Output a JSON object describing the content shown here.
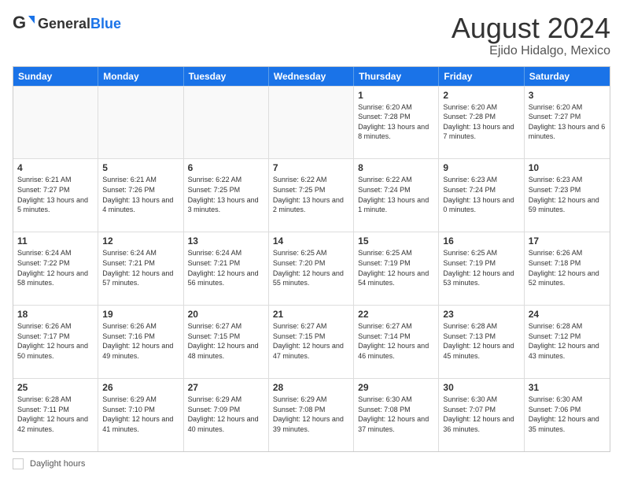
{
  "header": {
    "logo_general": "General",
    "logo_blue": "Blue",
    "main_title": "August 2024",
    "sub_title": "Ejido Hidalgo, Mexico"
  },
  "calendar": {
    "days_of_week": [
      "Sunday",
      "Monday",
      "Tuesday",
      "Wednesday",
      "Thursday",
      "Friday",
      "Saturday"
    ],
    "rows": [
      [
        {
          "day": "",
          "info": ""
        },
        {
          "day": "",
          "info": ""
        },
        {
          "day": "",
          "info": ""
        },
        {
          "day": "",
          "info": ""
        },
        {
          "day": "1",
          "info": "Sunrise: 6:20 AM\nSunset: 7:28 PM\nDaylight: 13 hours and 8 minutes."
        },
        {
          "day": "2",
          "info": "Sunrise: 6:20 AM\nSunset: 7:28 PM\nDaylight: 13 hours and 7 minutes."
        },
        {
          "day": "3",
          "info": "Sunrise: 6:20 AM\nSunset: 7:27 PM\nDaylight: 13 hours and 6 minutes."
        }
      ],
      [
        {
          "day": "4",
          "info": "Sunrise: 6:21 AM\nSunset: 7:27 PM\nDaylight: 13 hours and 5 minutes."
        },
        {
          "day": "5",
          "info": "Sunrise: 6:21 AM\nSunset: 7:26 PM\nDaylight: 13 hours and 4 minutes."
        },
        {
          "day": "6",
          "info": "Sunrise: 6:22 AM\nSunset: 7:25 PM\nDaylight: 13 hours and 3 minutes."
        },
        {
          "day": "7",
          "info": "Sunrise: 6:22 AM\nSunset: 7:25 PM\nDaylight: 13 hours and 2 minutes."
        },
        {
          "day": "8",
          "info": "Sunrise: 6:22 AM\nSunset: 7:24 PM\nDaylight: 13 hours and 1 minute."
        },
        {
          "day": "9",
          "info": "Sunrise: 6:23 AM\nSunset: 7:24 PM\nDaylight: 13 hours and 0 minutes."
        },
        {
          "day": "10",
          "info": "Sunrise: 6:23 AM\nSunset: 7:23 PM\nDaylight: 12 hours and 59 minutes."
        }
      ],
      [
        {
          "day": "11",
          "info": "Sunrise: 6:24 AM\nSunset: 7:22 PM\nDaylight: 12 hours and 58 minutes."
        },
        {
          "day": "12",
          "info": "Sunrise: 6:24 AM\nSunset: 7:21 PM\nDaylight: 12 hours and 57 minutes."
        },
        {
          "day": "13",
          "info": "Sunrise: 6:24 AM\nSunset: 7:21 PM\nDaylight: 12 hours and 56 minutes."
        },
        {
          "day": "14",
          "info": "Sunrise: 6:25 AM\nSunset: 7:20 PM\nDaylight: 12 hours and 55 minutes."
        },
        {
          "day": "15",
          "info": "Sunrise: 6:25 AM\nSunset: 7:19 PM\nDaylight: 12 hours and 54 minutes."
        },
        {
          "day": "16",
          "info": "Sunrise: 6:25 AM\nSunset: 7:19 PM\nDaylight: 12 hours and 53 minutes."
        },
        {
          "day": "17",
          "info": "Sunrise: 6:26 AM\nSunset: 7:18 PM\nDaylight: 12 hours and 52 minutes."
        }
      ],
      [
        {
          "day": "18",
          "info": "Sunrise: 6:26 AM\nSunset: 7:17 PM\nDaylight: 12 hours and 50 minutes."
        },
        {
          "day": "19",
          "info": "Sunrise: 6:26 AM\nSunset: 7:16 PM\nDaylight: 12 hours and 49 minutes."
        },
        {
          "day": "20",
          "info": "Sunrise: 6:27 AM\nSunset: 7:15 PM\nDaylight: 12 hours and 48 minutes."
        },
        {
          "day": "21",
          "info": "Sunrise: 6:27 AM\nSunset: 7:15 PM\nDaylight: 12 hours and 47 minutes."
        },
        {
          "day": "22",
          "info": "Sunrise: 6:27 AM\nSunset: 7:14 PM\nDaylight: 12 hours and 46 minutes."
        },
        {
          "day": "23",
          "info": "Sunrise: 6:28 AM\nSunset: 7:13 PM\nDaylight: 12 hours and 45 minutes."
        },
        {
          "day": "24",
          "info": "Sunrise: 6:28 AM\nSunset: 7:12 PM\nDaylight: 12 hours and 43 minutes."
        }
      ],
      [
        {
          "day": "25",
          "info": "Sunrise: 6:28 AM\nSunset: 7:11 PM\nDaylight: 12 hours and 42 minutes."
        },
        {
          "day": "26",
          "info": "Sunrise: 6:29 AM\nSunset: 7:10 PM\nDaylight: 12 hours and 41 minutes."
        },
        {
          "day": "27",
          "info": "Sunrise: 6:29 AM\nSunset: 7:09 PM\nDaylight: 12 hours and 40 minutes."
        },
        {
          "day": "28",
          "info": "Sunrise: 6:29 AM\nSunset: 7:08 PM\nDaylight: 12 hours and 39 minutes."
        },
        {
          "day": "29",
          "info": "Sunrise: 6:30 AM\nSunset: 7:08 PM\nDaylight: 12 hours and 37 minutes."
        },
        {
          "day": "30",
          "info": "Sunrise: 6:30 AM\nSunset: 7:07 PM\nDaylight: 12 hours and 36 minutes."
        },
        {
          "day": "31",
          "info": "Sunrise: 6:30 AM\nSunset: 7:06 PM\nDaylight: 12 hours and 35 minutes."
        }
      ]
    ]
  },
  "footer": {
    "daylight_label": "Daylight hours"
  }
}
